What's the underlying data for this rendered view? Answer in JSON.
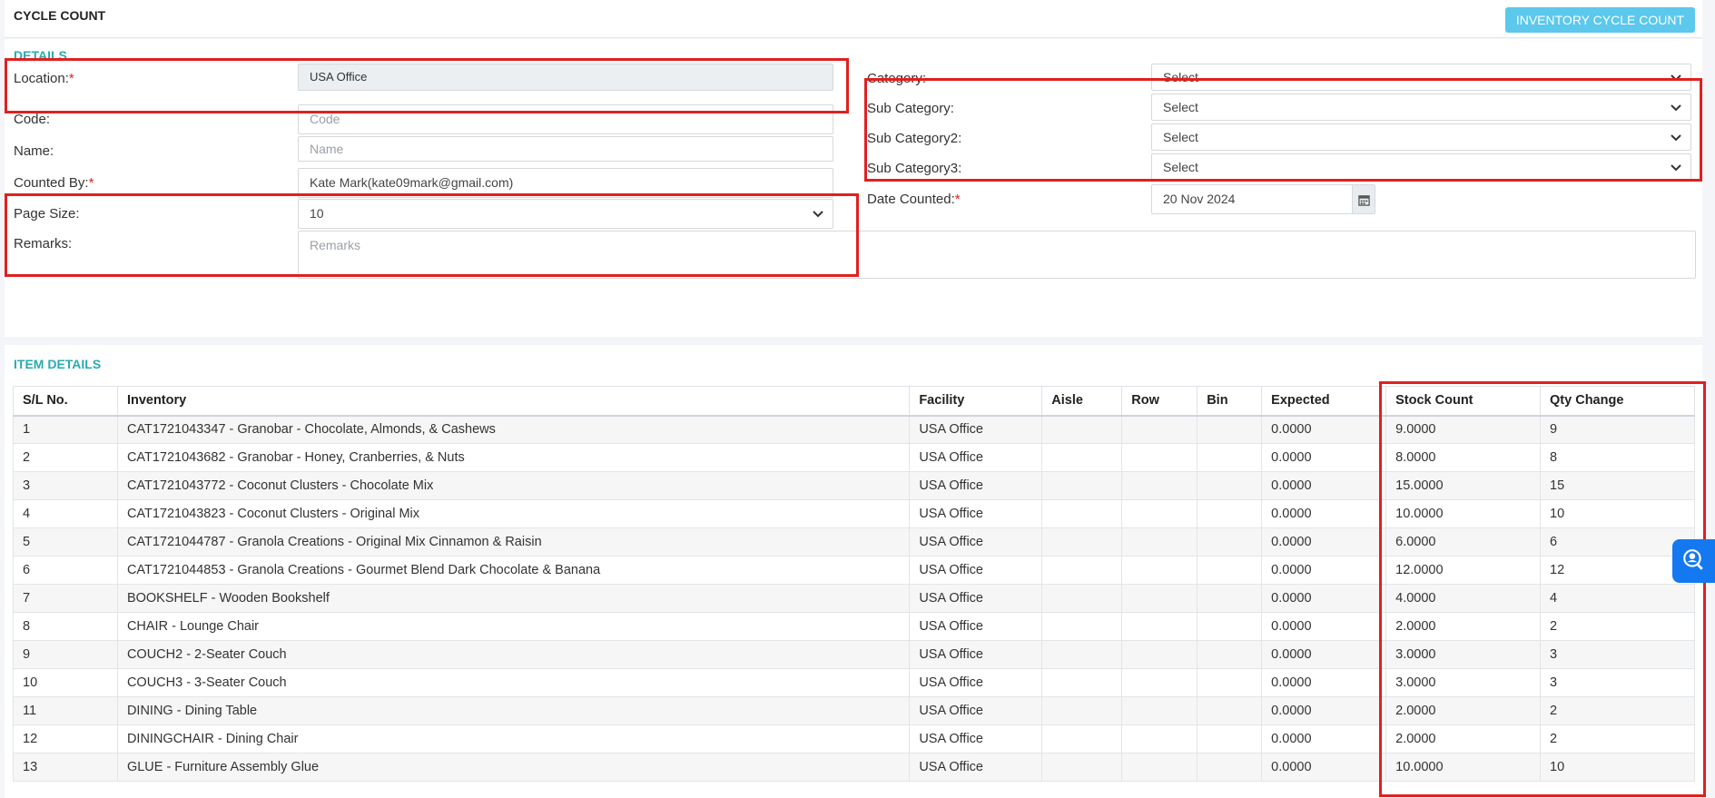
{
  "header": {
    "title": "CYCLE COUNT",
    "inventory_cycle_count_button": "INVENTORY CYCLE COUNT"
  },
  "details": {
    "section_title": "DETAILS",
    "location": {
      "label": "Location:",
      "required": "*",
      "value": "USA Office"
    },
    "code": {
      "label": "Code:",
      "placeholder": "Code"
    },
    "name": {
      "label": "Name:",
      "placeholder": "Name"
    },
    "counted_by": {
      "label": "Counted By:",
      "required": "*",
      "value": "Kate Mark(kate09mark@gmail.com)"
    },
    "page_size": {
      "label": "Page Size:",
      "value": "10"
    },
    "remarks": {
      "label": "Remarks:",
      "placeholder": "Remarks"
    },
    "category": {
      "label": "Category:",
      "value": "Select"
    },
    "sub_category": {
      "label": "Sub Category:",
      "value": "Select"
    },
    "sub_category2": {
      "label": "Sub Category2:",
      "value": "Select"
    },
    "sub_category3": {
      "label": "Sub Category3:",
      "value": "Select"
    },
    "date_counted": {
      "label": "Date Counted:",
      "required": "*",
      "value": "20 Nov 2024"
    }
  },
  "item_details": {
    "section_title": "ITEM DETAILS",
    "columns": [
      "S/L No.",
      "Inventory",
      "Facility",
      "Aisle",
      "Row",
      "Bin",
      "Expected",
      "Stock Count",
      "Qty Change"
    ],
    "rows": [
      [
        "1",
        "CAT1721043347 - Granobar - Chocolate, Almonds, & Cashews",
        "USA Office",
        "",
        "",
        "",
        "0.0000",
        "9.0000",
        "9"
      ],
      [
        "2",
        "CAT1721043682 - Granobar - Honey, Cranberries, & Nuts",
        "USA Office",
        "",
        "",
        "",
        "0.0000",
        "8.0000",
        "8"
      ],
      [
        "3",
        "CAT1721043772 - Coconut Clusters - Chocolate Mix",
        "USA Office",
        "",
        "",
        "",
        "0.0000",
        "15.0000",
        "15"
      ],
      [
        "4",
        "CAT1721043823 - Coconut Clusters - Original Mix",
        "USA Office",
        "",
        "",
        "",
        "0.0000",
        "10.0000",
        "10"
      ],
      [
        "5",
        "CAT1721044787 - Granola Creations - Original Mix Cinnamon & Raisin",
        "USA Office",
        "",
        "",
        "",
        "0.0000",
        "6.0000",
        "6"
      ],
      [
        "6",
        "CAT1721044853 - Granola Creations - Gourmet Blend Dark Chocolate & Banana",
        "USA Office",
        "",
        "",
        "",
        "0.0000",
        "12.0000",
        "12"
      ],
      [
        "7",
        "BOOKSHELF - Wooden Bookshelf",
        "USA Office",
        "",
        "",
        "",
        "0.0000",
        "4.0000",
        "4"
      ],
      [
        "8",
        "CHAIR - Lounge Chair",
        "USA Office",
        "",
        "",
        "",
        "0.0000",
        "2.0000",
        "2"
      ],
      [
        "9",
        "COUCH2 - 2-Seater Couch",
        "USA Office",
        "",
        "",
        "",
        "0.0000",
        "3.0000",
        "3"
      ],
      [
        "10",
        "COUCH3 - 3-Seater Couch",
        "USA Office",
        "",
        "",
        "",
        "0.0000",
        "3.0000",
        "3"
      ],
      [
        "11",
        "DINING - Dining Table",
        "USA Office",
        "",
        "",
        "",
        "0.0000",
        "2.0000",
        "2"
      ],
      [
        "12",
        "DININGCHAIR - Dining Chair",
        "USA Office",
        "",
        "",
        "",
        "0.0000",
        "2.0000",
        "2"
      ],
      [
        "13",
        "GLUE - Furniture Assembly Glue",
        "USA Office",
        "",
        "",
        "",
        "0.0000",
        "10.0000",
        "10"
      ]
    ]
  },
  "icons": {
    "calendar": "calendar-icon",
    "chevron": "chevron-down-icon",
    "support": "support-chat-icon"
  },
  "colors": {
    "accent": "#29aab0",
    "button": "#5bc8ec",
    "required": "#e02020",
    "highlight": "#e02020",
    "float_button": "#1479f0"
  }
}
